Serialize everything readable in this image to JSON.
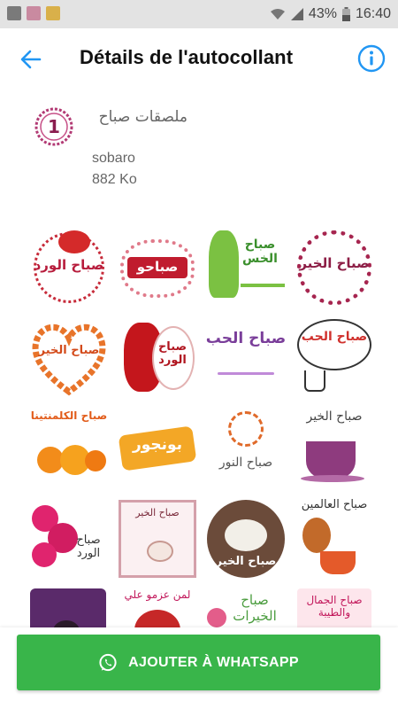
{
  "status_bar": {
    "battery_text": "43%",
    "time": "16:40"
  },
  "app_bar": {
    "title": "Détails de l'autocollant"
  },
  "pack": {
    "icon_number": "1",
    "name": "ملصقات صباح",
    "author": "sobaro",
    "size": "882 Ko"
  },
  "stickers": [
    {
      "text": "صباح الورد"
    },
    {
      "text": "صباحو"
    },
    {
      "text": "صباح الخس"
    },
    {
      "text": "صباح الخير"
    },
    {
      "text": "صباح الخير"
    },
    {
      "text": "صباح الورد"
    },
    {
      "text": "صباح الحب"
    },
    {
      "text": "صباح الحب"
    },
    {
      "text": "صباح الكلمنتينا"
    },
    {
      "text": "بونجور"
    },
    {
      "text": "صباح النور"
    },
    {
      "text": "صباح الخير"
    },
    {
      "text": "صباح الورد"
    },
    {
      "text": "صباح الخير"
    },
    {
      "text": "صباح الخير"
    },
    {
      "text": "صباح العالمين"
    },
    {
      "text": ""
    },
    {
      "text": "لمن عزمو علي"
    },
    {
      "text": "صباح الخيرات"
    },
    {
      "text": "صباح الجمال والطيبة"
    }
  ],
  "action": {
    "label": "AJOUTER À WHATSAPP"
  },
  "colors": {
    "accent": "#2196f3",
    "whatsapp_green": "#39b54a",
    "status_bar_bg": "#e3e3e3"
  }
}
